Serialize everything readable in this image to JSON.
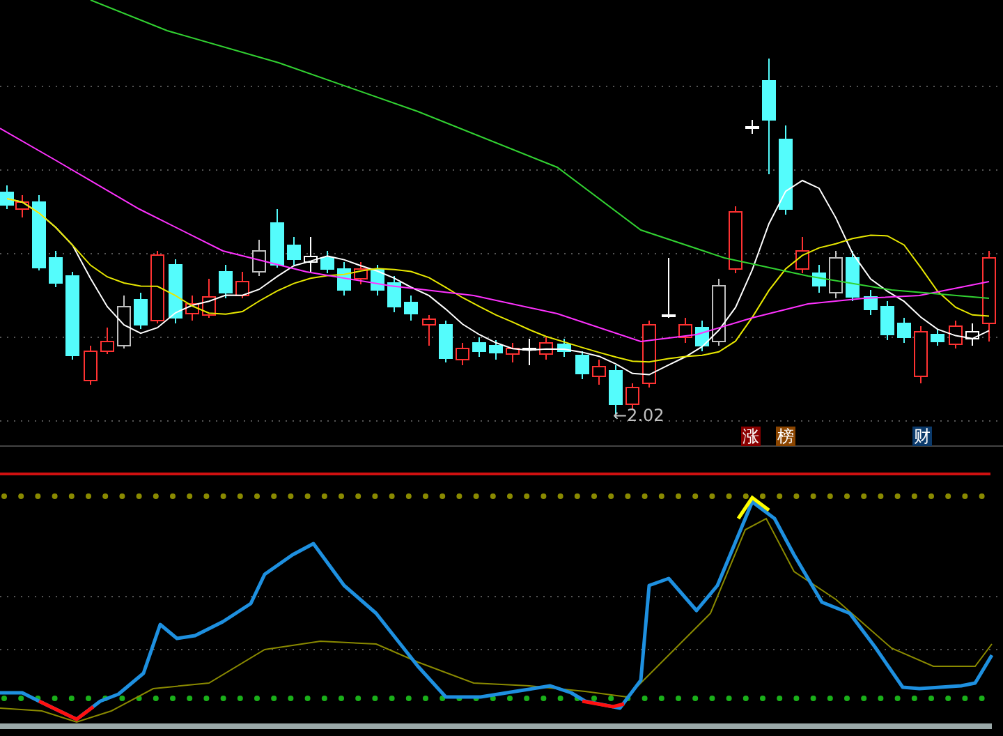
{
  "price_panel": {
    "low_marker": "←2.02"
  },
  "event_badges": [
    {
      "label": "涨",
      "color": "#8b0000"
    },
    {
      "label": "榜",
      "color": "#8b4500"
    },
    {
      "label": "财",
      "color": "#0b3a6b"
    }
  ]
}
